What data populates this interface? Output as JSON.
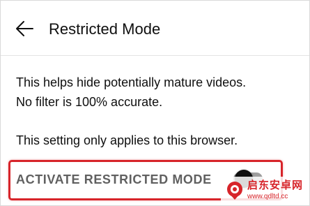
{
  "header": {
    "back_icon": "arrow-left-icon",
    "title": "Restricted Mode"
  },
  "content": {
    "description_line1": "This helps hide potentially mature videos.",
    "description_line2": "No filter is 100% accurate.",
    "note": "This setting only applies to this browser."
  },
  "toggle": {
    "label": "ACTIVATE RESTRICTED MODE",
    "state": "on"
  },
  "highlight": {
    "color": "#d7242a"
  },
  "watermark": {
    "name": "启东安卓网",
    "url": "www.qdltd.cc",
    "logo_icon": "location-pin-logo"
  }
}
